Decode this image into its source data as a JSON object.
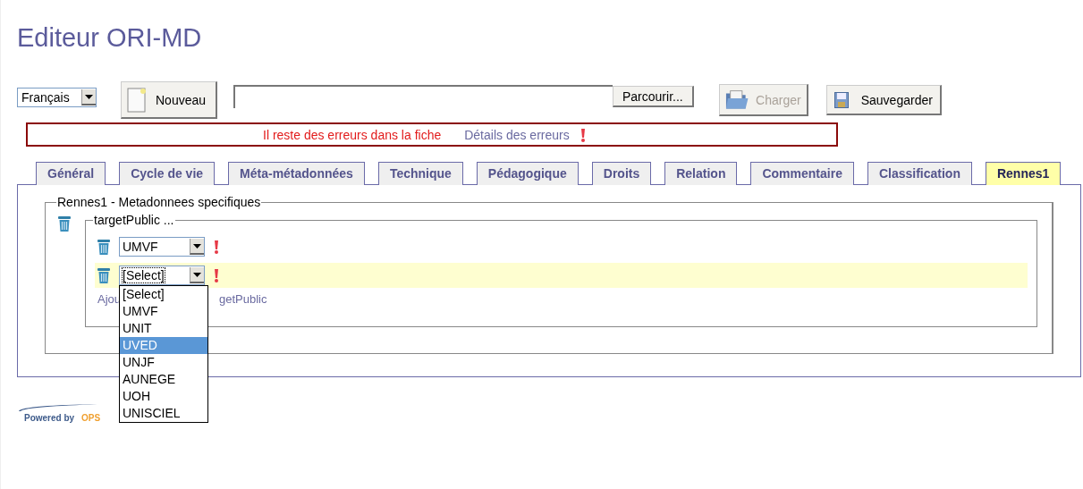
{
  "window": {
    "title": "Editeur ORI-MD"
  },
  "language_select": {
    "value": "Français"
  },
  "toolbar": {
    "new_button": "Nouveau",
    "browse_button": "Parcourir...",
    "load_button": {
      "label": "Charger",
      "disabled": true
    },
    "save_button": {
      "label": "Sauvegarder",
      "disabled": false
    }
  },
  "error_banner": {
    "message": "Il reste des erreurs dans la fiche",
    "details_link": "Détails des erreurs"
  },
  "tabs": [
    {
      "label": "Général",
      "selected": false
    },
    {
      "label": "Cycle de vie",
      "selected": false
    },
    {
      "label": "Méta-métadonnées",
      "selected": false
    },
    {
      "label": "Technique",
      "selected": false
    },
    {
      "label": "Pédagogique",
      "selected": false
    },
    {
      "label": "Droits",
      "selected": false
    },
    {
      "label": "Relation",
      "selected": false
    },
    {
      "label": "Commentaire",
      "selected": false
    },
    {
      "label": "Classification",
      "selected": false
    },
    {
      "label": "Rennes1",
      "selected": true
    }
  ],
  "section": {
    "legend": "Rennes1 - Metadonnees specifiques",
    "group": {
      "legend": "targetPublic ...",
      "entries": [
        {
          "value": "UMVF",
          "highlighted": false,
          "error": true,
          "open": false
        },
        {
          "value": "[Select]",
          "highlighted": true,
          "error": true,
          "open": true
        }
      ],
      "dropdown_options": [
        {
          "label": "[Select]",
          "selected": false
        },
        {
          "label": "UMVF",
          "selected": false
        },
        {
          "label": "UNIT",
          "selected": false
        },
        {
          "label": "UVED",
          "selected": true
        },
        {
          "label": "UNJF",
          "selected": false
        },
        {
          "label": "AUNEGE",
          "selected": false
        },
        {
          "label": "UOH",
          "selected": false
        },
        {
          "label": "UNISCIEL",
          "selected": false
        }
      ],
      "add_link": {
        "before": "Ajou",
        "after": "getPublic"
      }
    }
  },
  "footer": {
    "logo_text": "Powered by",
    "logo_brand": "OPS"
  }
}
